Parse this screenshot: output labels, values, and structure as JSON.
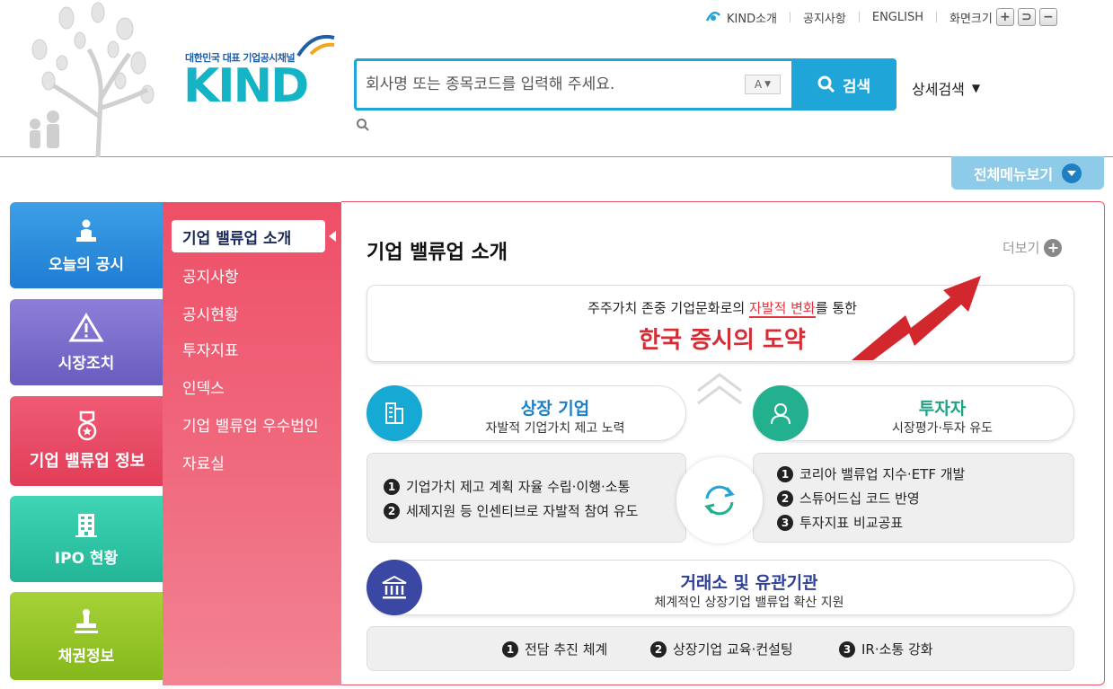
{
  "header": {
    "logo": {
      "tagline": "대한민국 대표 기업공시채널",
      "wordmark": "KIND"
    },
    "util_nav": {
      "about": "KIND소개",
      "notice": "공지사항",
      "english": "ENGLISH",
      "screen_size": "화면크기",
      "zoom_in": "+",
      "zoom_reset": "⊃",
      "zoom_out": "−"
    },
    "search": {
      "placeholder": "회사명 또는 종목코드를 입력해 주세요.",
      "font_toggle": "A",
      "button_label": "검색",
      "advanced_label": "상세검색"
    },
    "all_menu_label": "전체메뉴보기"
  },
  "categories": [
    {
      "label": "오늘의 공시",
      "icon": "person-podium-icon",
      "color": "#2a8bdc"
    },
    {
      "label": "시장조치",
      "icon": "warning-triangle-icon",
      "color": "#7a6dcc"
    },
    {
      "label": "기업 밸류업 정보",
      "icon": "medal-icon",
      "color": "#e84a64"
    },
    {
      "label": "IPO 현황",
      "icon": "building-icon",
      "color": "#2ec5a3"
    },
    {
      "label": "채권정보",
      "icon": "stamp-icon",
      "color": "#95c62a"
    }
  ],
  "submenu": {
    "active": "기업 밸류업 소개",
    "items": [
      "공지사항",
      "공시현황",
      "투자지표",
      "인덱스",
      "기업 밸류업 우수법인",
      "자료실"
    ]
  },
  "panel": {
    "title": "기업 밸류업 소개",
    "more_label": "더보기",
    "banner": {
      "sub_prefix": "주주가치 존중 기업문화로의 ",
      "sub_highlight": "자발적 변화",
      "sub_suffix": "를 통한",
      "main": "한국 증시의 도약"
    },
    "company": {
      "title": "상장 기업",
      "subtitle": "자발적 기업가치 제고 노력",
      "items": [
        "기업가치 제고 계획 자율 수립·이행·소통",
        "세제지원 등 인센티브로 자발적 참여 유도"
      ]
    },
    "investor": {
      "title": "투자자",
      "subtitle": "시장평가·투자 유도",
      "items": [
        "코리아 밸류업 지수·ETF 개발",
        "스튜어드십 코드 반영",
        "투자지표 비교공표"
      ]
    },
    "exchange": {
      "title": "거래소 및 유관기관",
      "subtitle": "체계적인 상장기업 밸류업 확산 지원",
      "items": [
        "전담 추진 체계",
        "상장기업 교육·컨설팅",
        "IR·소통 강화"
      ]
    },
    "numbers": [
      "1",
      "2",
      "3"
    ]
  },
  "colors": {
    "accent_blue": "#1fa5d8",
    "valueup_red": "#e84a64",
    "banner_red": "#d42d35"
  }
}
